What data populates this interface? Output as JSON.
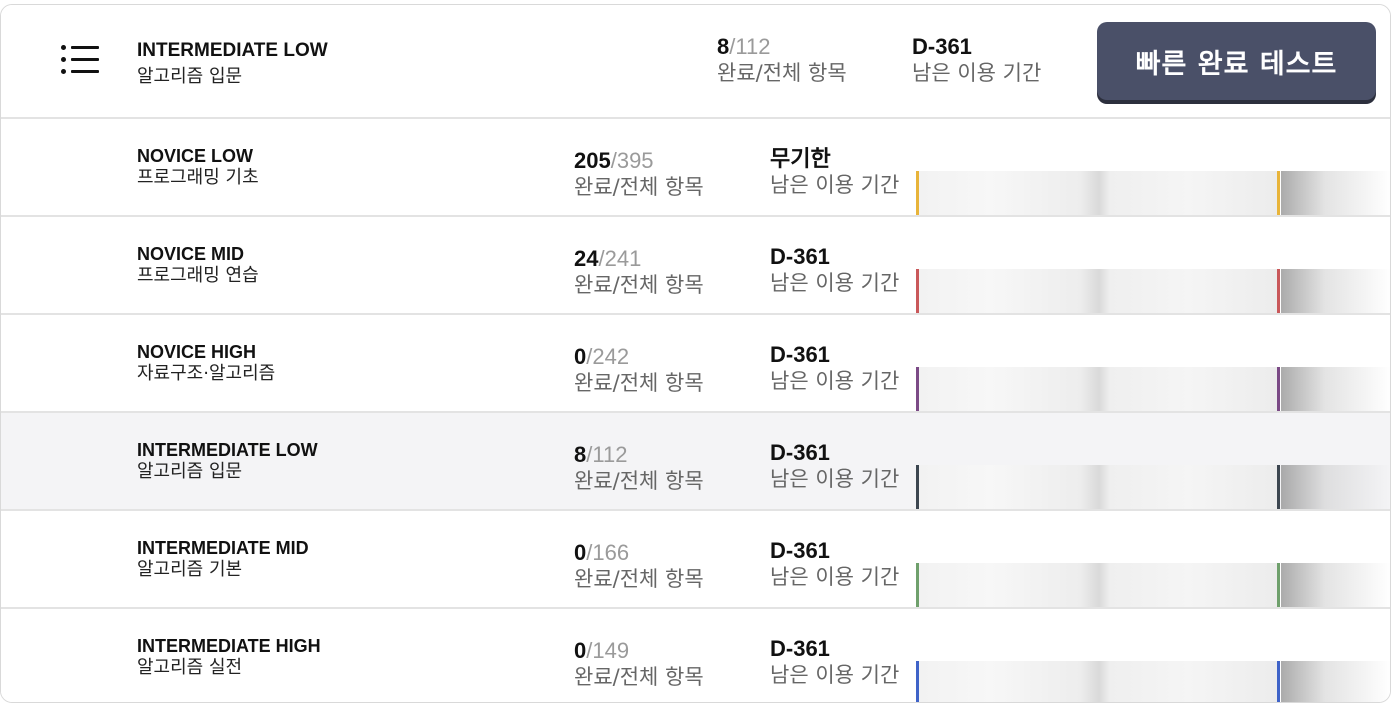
{
  "header": {
    "menu_icon": "hamburger-list-icon",
    "course_code": "INTERMEDIATE LOW",
    "course_name": "알고리즘 입문",
    "completed": "8",
    "total": "/112",
    "progress_label": "완료/전체 항목",
    "period_value": "D-361",
    "period_label": "남은 이용 기간",
    "quick_test_label": "빠른 완료 테스트"
  },
  "courses": [
    {
      "code": "NOVICE LOW",
      "name": "프로그래밍 기초",
      "completed": "205",
      "total": "/395",
      "progress_label": "완료/전체 항목",
      "period_value": "무기한",
      "period_label": "남은 이용 기간",
      "color": "#e8b43a",
      "active": false
    },
    {
      "code": "NOVICE MID",
      "name": "프로그래밍 연습",
      "completed": "24",
      "total": "/241",
      "progress_label": "완료/전체 항목",
      "period_value": "D-361",
      "period_label": "남은 이용 기간",
      "color": "#c9585a",
      "active": false
    },
    {
      "code": "NOVICE HIGH",
      "name": "자료구조·알고리즘",
      "completed": "0",
      "total": "/242",
      "progress_label": "완료/전체 항목",
      "period_value": "D-361",
      "period_label": "남은 이용 기간",
      "color": "#7b4a86",
      "active": false
    },
    {
      "code": "INTERMEDIATE LOW",
      "name": "알고리즘 입문",
      "completed": "8",
      "total": "/112",
      "progress_label": "완료/전체 항목",
      "period_value": "D-361",
      "period_label": "남은 이용 기간",
      "color": "#3c4650",
      "active": true
    },
    {
      "code": "INTERMEDIATE MID",
      "name": "알고리즘 기본",
      "completed": "0",
      "total": "/166",
      "progress_label": "완료/전체 항목",
      "period_value": "D-361",
      "period_label": "남은 이용 기간",
      "color": "#6fa06c",
      "active": false
    },
    {
      "code": "INTERMEDIATE HIGH",
      "name": "알고리즘 실전",
      "completed": "0",
      "total": "/149",
      "progress_label": "완료/전체 항목",
      "period_value": "D-361",
      "period_label": "남은 이용 기간",
      "color": "#3f63c8",
      "active": false
    }
  ]
}
